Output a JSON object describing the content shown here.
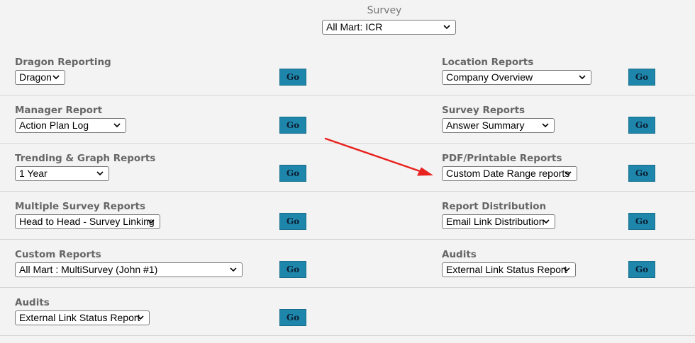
{
  "survey": {
    "label": "Survey",
    "selected": "All Mart: ICR"
  },
  "go_label": "Go",
  "left_sections": [
    {
      "title": "Dragon Reporting",
      "selected": "Dragon"
    },
    {
      "title": "Manager Report",
      "selected": "Action Plan Log"
    },
    {
      "title": "Trending & Graph Reports",
      "selected": "1 Year"
    },
    {
      "title": "Multiple Survey Reports",
      "selected": "Head to Head - Survey Linking"
    },
    {
      "title": "Custom Reports",
      "selected": "All Mart : MultiSurvey (John #1)"
    },
    {
      "title": "Audits",
      "selected": "External Link Status Report"
    }
  ],
  "right_sections": [
    {
      "title": "Location Reports",
      "selected": "Company Overview"
    },
    {
      "title": "Survey Reports",
      "selected": "Answer Summary"
    },
    {
      "title": "PDF/Printable Reports",
      "selected": "Custom Date Range reports"
    },
    {
      "title": "Report Distribution",
      "selected": "Email Link Distribution"
    },
    {
      "title": "Audits",
      "selected": "External Link Status Report"
    }
  ],
  "colors": {
    "go_button": "#1e86aa",
    "annotation_arrow": "#e8221e",
    "section_title": "#666666",
    "background": "#f3f3f3"
  }
}
